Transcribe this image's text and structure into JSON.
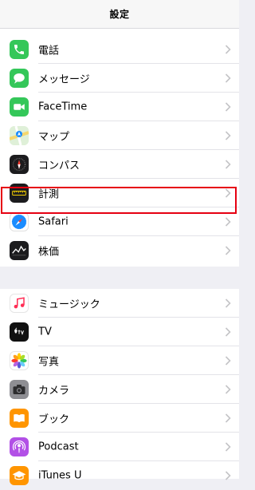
{
  "header": {
    "title": "設定"
  },
  "group1": [
    {
      "label": "電話",
      "icon": "phone-icon",
      "color": "#34c759"
    },
    {
      "label": "メッセージ",
      "icon": "messages-icon",
      "color": "#34c759"
    },
    {
      "label": "FaceTime",
      "icon": "facetime-icon",
      "color": "#34c759"
    },
    {
      "label": "マップ",
      "icon": "maps-icon",
      "color": "#5ac8fa"
    },
    {
      "label": "コンパス",
      "icon": "compass-icon",
      "color": "#1c1c1e"
    },
    {
      "label": "計測",
      "icon": "measure-icon",
      "color": "#1c1c1e"
    },
    {
      "label": "Safari",
      "icon": "safari-icon",
      "color": "#1a8cff"
    },
    {
      "label": "株価",
      "icon": "stocks-icon",
      "color": "#1c1c1e"
    }
  ],
  "group2": [
    {
      "label": "ミュージック",
      "icon": "music-icon",
      "color": "#ff2d55"
    },
    {
      "label": "TV",
      "icon": "tv-icon",
      "color": "#111111"
    },
    {
      "label": "写真",
      "icon": "photos-icon",
      "color": "#ffffff"
    },
    {
      "label": "カメラ",
      "icon": "camera-icon",
      "color": "#8e8e93"
    },
    {
      "label": "ブック",
      "icon": "books-icon",
      "color": "#ff9500"
    },
    {
      "label": "Podcast",
      "icon": "podcasts-icon",
      "color": "#b250e6"
    },
    {
      "label": "iTunes U",
      "icon": "itunes-u-icon",
      "color": "#ff9500"
    }
  ],
  "selected": "Safari"
}
